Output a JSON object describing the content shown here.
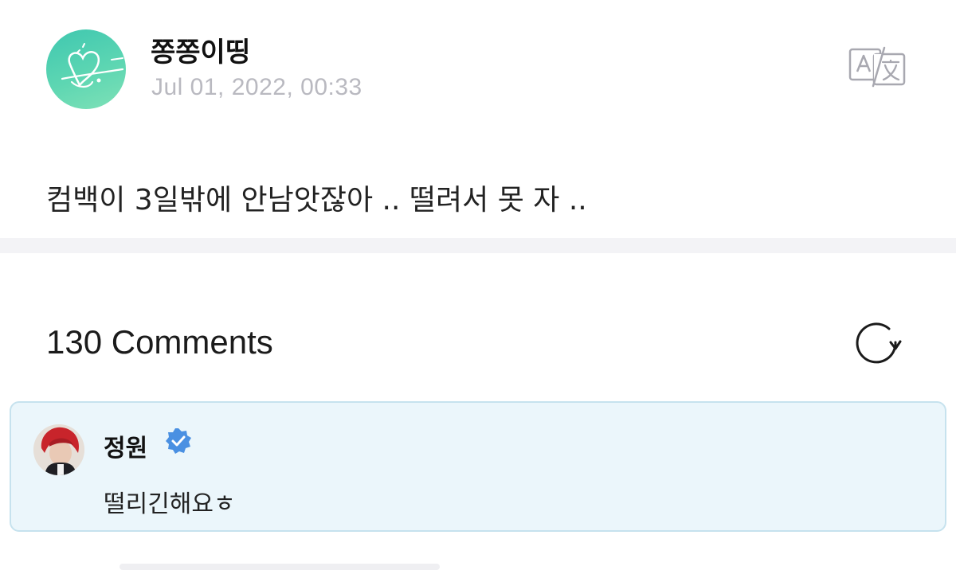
{
  "post": {
    "author": "쫑쫑이띵",
    "timestamp": "Jul 01, 2022, 00:33",
    "body": "컴백이 3일밖에 안남앗잖아 .. 떨려서 못 자 ..",
    "translate_icon": "translate-icon"
  },
  "comments": {
    "count_label": "130 Comments",
    "refresh_icon": "refresh-icon",
    "items": [
      {
        "author": "정원",
        "verified": true,
        "text": "떨리긴해요ㅎ",
        "highlight_color": "#ebf6fb"
      }
    ]
  },
  "colors": {
    "verified_badge": "#4a90e2",
    "avatar_gradient_start": "#3fc7b0",
    "avatar_gradient_end": "#7fe1b7"
  }
}
